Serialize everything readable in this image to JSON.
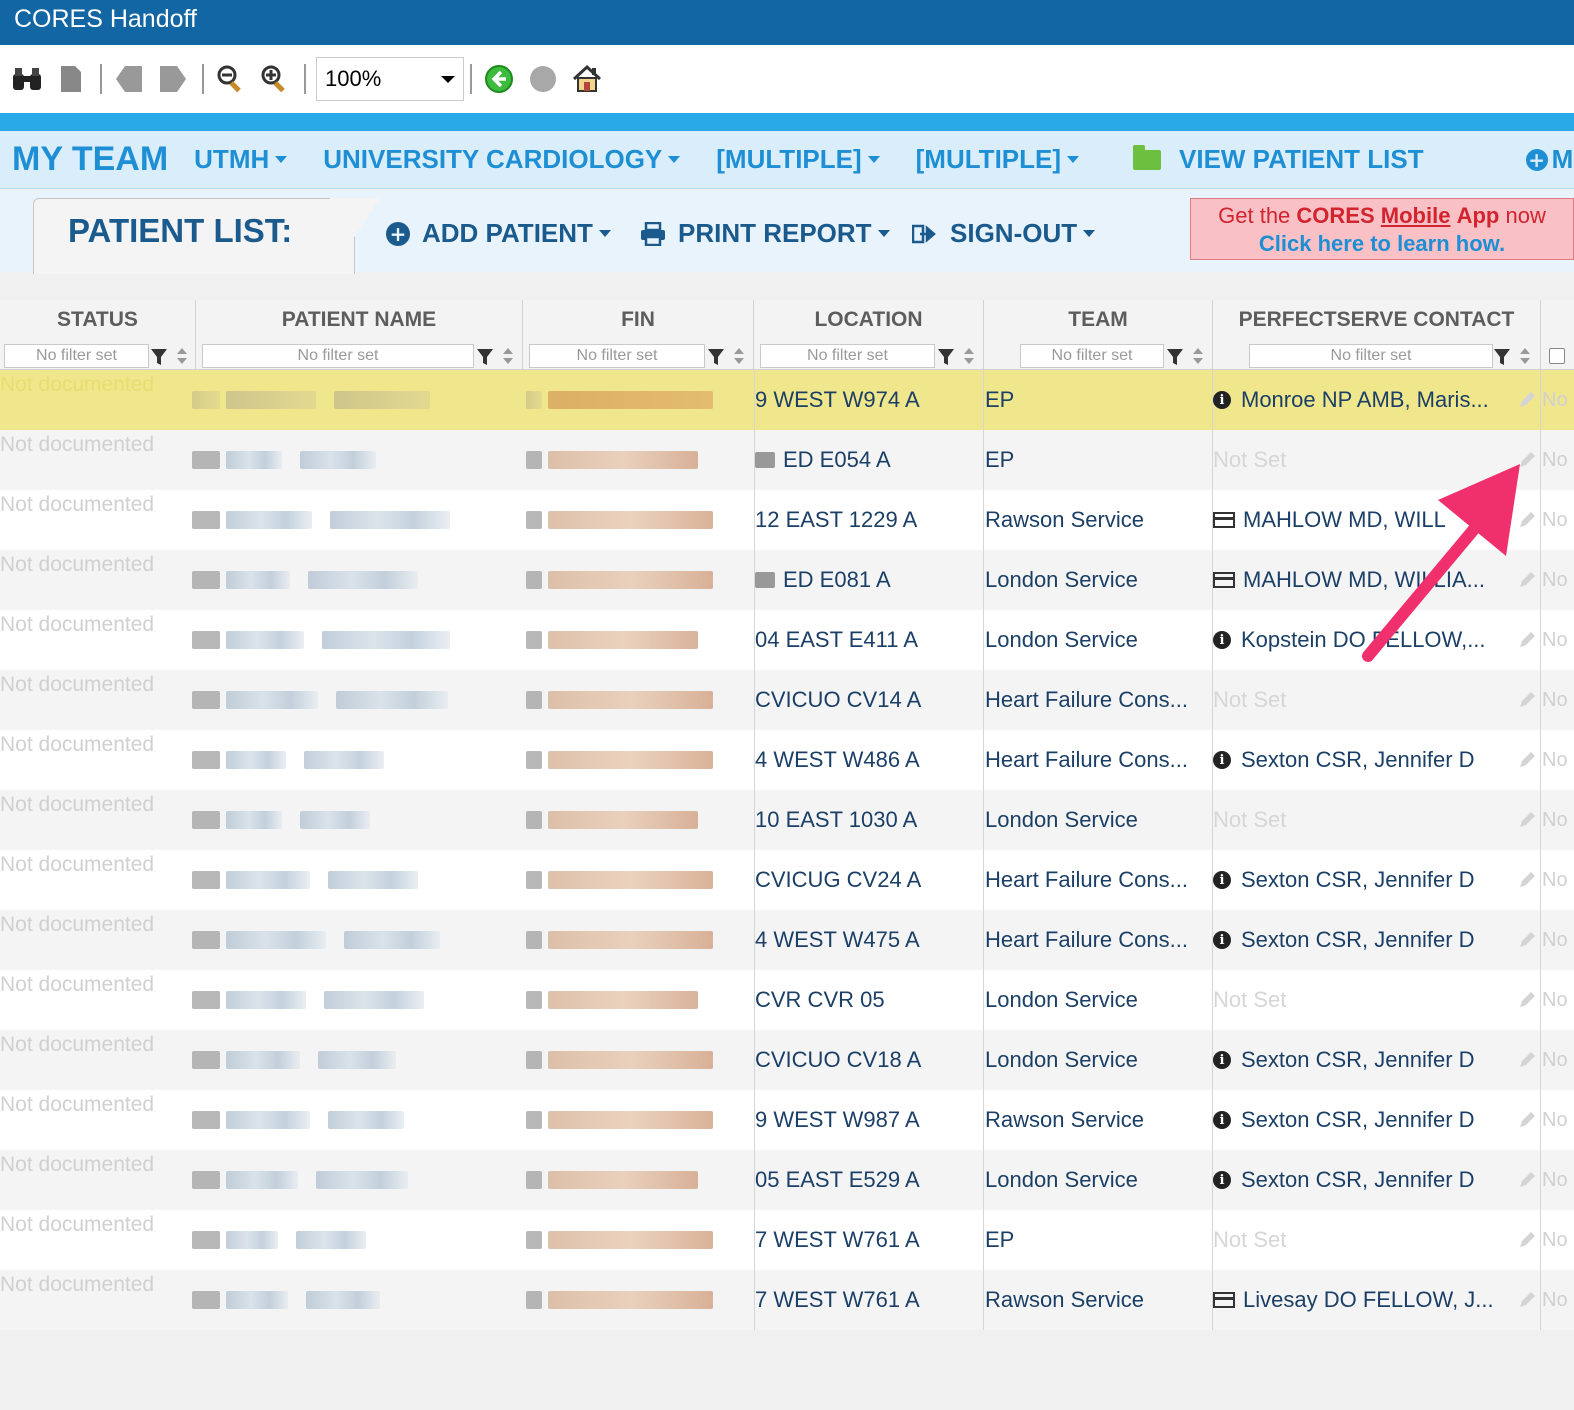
{
  "window": {
    "title": "CORES Handoff"
  },
  "toolbar": {
    "zoom": "100%",
    "icons": [
      "binoculars-icon",
      "page-icon",
      "back-page-icon",
      "forward-page-icon",
      "zoom-out-icon",
      "zoom-in-icon",
      "go-back-icon",
      "stop-icon",
      "home-icon"
    ]
  },
  "teamnav": {
    "title": "MY TEAM",
    "items": [
      "UTMH",
      "UNIVERSITY CARDIOLOGY",
      "[MULTIPLE]",
      "[MULTIPLE]"
    ],
    "view_patient_list": "VIEW PATIENT LIST",
    "more": "MO"
  },
  "patient_list": {
    "tab_label": "PATIENT LIST:",
    "add_patient": "ADD PATIENT",
    "print_report": "PRINT REPORT",
    "sign_out": "SIGN-OUT"
  },
  "promo": {
    "line1_prefix": "Get the ",
    "line1_cores": "CORES",
    "line1_mobile": "Mobile",
    "line1_app": "App",
    "line1_suffix": " now",
    "line2": "Click here to learn how."
  },
  "grid": {
    "columns": [
      "STATUS",
      "PATIENT NAME",
      "FIN",
      "LOCATION",
      "TEAM",
      "PERFECTSERVE CONTACT"
    ],
    "filter_placeholder": "No filter set",
    "rows": [
      {
        "status": "Not documented",
        "location": "9 WEST W974 A",
        "team": "EP",
        "contact": "Monroe NP AMB, Maris...",
        "contact_icon": "info",
        "extra": "No"
      },
      {
        "status": "Not documented",
        "location": "ED E054 A",
        "loc_icon": "ambulance",
        "team": "EP",
        "contact": "Not Set",
        "contact_icon": "none",
        "extra": "No"
      },
      {
        "status": "Not documented",
        "location": "12 EAST 1229 A",
        "team": "Rawson Service",
        "contact": "MAHLOW MD, WILL",
        "contact_icon": "card",
        "extra": "No"
      },
      {
        "status": "Not documented",
        "location": "ED E081 A",
        "loc_icon": "ambulance",
        "team": "London Service",
        "contact": "MAHLOW MD, WILLIA...",
        "contact_icon": "card",
        "extra": "No"
      },
      {
        "status": "Not documented",
        "location": "04 EAST E411 A",
        "team": "London Service",
        "contact": "Kopstein DO FELLOW,...",
        "contact_icon": "info",
        "extra": "No"
      },
      {
        "status": "Not documented",
        "location": "CVICUO CV14 A",
        "team": "Heart Failure Cons...",
        "contact": "Not Set",
        "contact_icon": "none",
        "extra": "No"
      },
      {
        "status": "Not documented",
        "location": "4 WEST W486 A",
        "team": "Heart Failure Cons...",
        "contact": "Sexton CSR, Jennifer D",
        "contact_icon": "info",
        "extra": "No"
      },
      {
        "status": "Not documented",
        "location": "10 EAST 1030 A",
        "team": "London Service",
        "contact": "Not Set",
        "contact_icon": "none",
        "extra": "No"
      },
      {
        "status": "Not documented",
        "location": "CVICUG CV24 A",
        "team": "Heart Failure Cons...",
        "contact": "Sexton CSR, Jennifer D",
        "contact_icon": "info",
        "extra": "No"
      },
      {
        "status": "Not documented",
        "location": "4 WEST W475 A",
        "team": "Heart Failure Cons...",
        "contact": "Sexton CSR, Jennifer D",
        "contact_icon": "info",
        "extra": "No"
      },
      {
        "status": "Not documented",
        "location": "CVR CVR 05",
        "team": "London Service",
        "contact": "Not Set",
        "contact_icon": "none",
        "extra": "No"
      },
      {
        "status": "Not documented",
        "location": "CVICUO CV18 A",
        "team": "London Service",
        "contact": "Sexton CSR, Jennifer D",
        "contact_icon": "info",
        "extra": "No"
      },
      {
        "status": "Not documented",
        "location": "9 WEST W987 A",
        "team": "Rawson Service",
        "contact": "Sexton CSR, Jennifer D",
        "contact_icon": "info",
        "extra": "No"
      },
      {
        "status": "Not documented",
        "location": "05 EAST E529 A",
        "team": "London Service",
        "contact": "Sexton CSR, Jennifer D",
        "contact_icon": "info",
        "extra": "No"
      },
      {
        "status": "Not documented",
        "location": "7 WEST W761 A",
        "team": "EP",
        "contact": "Not Set",
        "contact_icon": "none",
        "extra": "No"
      },
      {
        "status": "Not documented",
        "location": "7 WEST W761 A",
        "team": "Rawson Service",
        "contact": "Livesay DO FELLOW, J...",
        "contact_icon": "card",
        "extra": "No"
      }
    ]
  },
  "colors": {
    "title_bar": "#1166a3",
    "accent": "#1e8fd4",
    "selected_row": "#f0e68c",
    "annotation_arrow": "#f0306c"
  }
}
